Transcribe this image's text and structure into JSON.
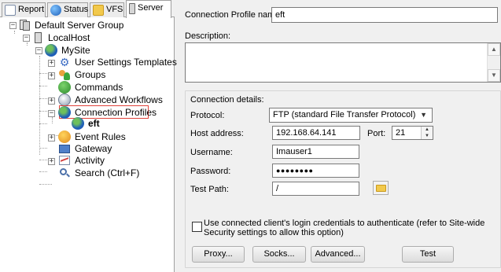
{
  "tabs": [
    {
      "label": "Report",
      "icon": "report-icon"
    },
    {
      "label": "Status",
      "icon": "status-globe-icon"
    },
    {
      "label": "VFS",
      "icon": "vfs-folder-icon"
    },
    {
      "label": "Server",
      "icon": "server-icon"
    }
  ],
  "active_tab": "Server",
  "tree": {
    "root": "Default Server Group",
    "localhost": "LocalHost",
    "site": "MySite",
    "site_children": [
      "User Settings Templates",
      "Groups",
      "Commands",
      "Advanced Workflows",
      "Connection Profiles"
    ],
    "profile_child": "eft",
    "site_children_after": [
      "Event Rules",
      "Gateway",
      "Activity",
      "Search (Ctrl+F)"
    ],
    "selected": "Connection Profiles",
    "highlight_color": "#e0423a"
  },
  "form": {
    "profile_name_label": "Connection Profile name:",
    "profile_name_value": "eft",
    "description_label": "Description:",
    "description_value": "",
    "details_label": "Connection details:",
    "protocol_label": "Protocol:",
    "protocol_value": "FTP (standard File Transfer Protocol)",
    "host_label": "Host address:",
    "host_value": "192.168.64.141",
    "port_label": "Port:",
    "port_value": "21",
    "username_label": "Username:",
    "username_value": "Imauser1",
    "password_label": "Password:",
    "password_value": "●●●●●●●●",
    "test_path_label": "Test Path:",
    "test_path_value": "/",
    "checkbox_line1": "Use connected client's login credentials to authenticate (refer to Site-wide",
    "checkbox_line2": "Security settings to allow this option)",
    "checkbox_checked": false,
    "buttons": {
      "proxy": "Proxy...",
      "socks": "Socks...",
      "advanced": "Advanced...",
      "test": "Test"
    }
  },
  "colors": {
    "window_bg": "#f0f0f0",
    "globe_blue": "#1f5fb8",
    "globe_green": "#3aa83a",
    "folder_yellow": "#f2c94c"
  }
}
